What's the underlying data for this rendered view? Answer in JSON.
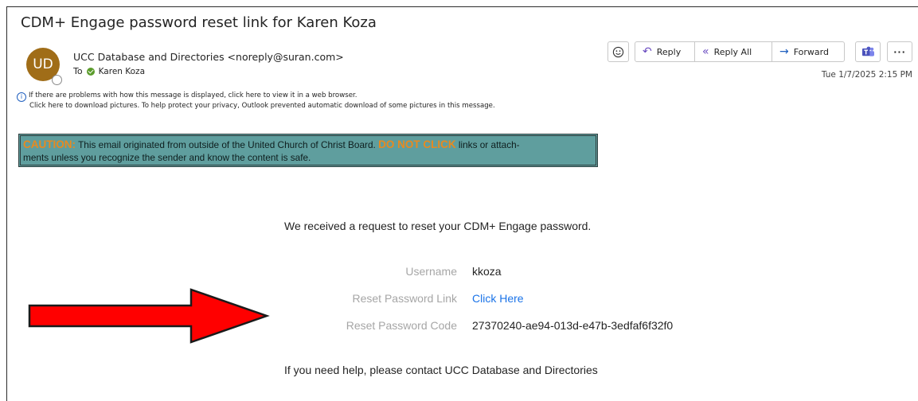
{
  "email": {
    "subject": "CDM+ Engage password reset link for Karen Koza",
    "avatar_initials": "UD",
    "sender": "UCC Database and Directories <noreply@suran.com>",
    "to_label": "To",
    "recipient": "Karen Koza",
    "date": "Tue 1/7/2025 2:15 PM",
    "info_line1": "If there are problems with how this message is displayed, click here to view it in a web browser.",
    "info_line2": "Click here to download pictures. To help protect your privacy, Outlook prevented automatic download of some pictures in this message."
  },
  "toolbar": {
    "reply_label": "Reply",
    "reply_all_label": "Reply All",
    "forward_label": "Forward"
  },
  "icons": {
    "emoji": "smiley-icon",
    "reply": "reply-arrow-icon",
    "reply_all": "reply-all-icon",
    "forward": "forward-arrow-icon",
    "teams": "teams-icon",
    "more": "more-icon",
    "info": "info-icon",
    "annotation": "red-arrow-icon"
  },
  "caution": {
    "prefix": "CAUTION:",
    "text1": " This email originated from outside of the United Church of Christ Board. ",
    "do_not_click": "DO NOT CLICK",
    "text2": " links or attach-",
    "text3": "ments unless you recognize the sender and know the content is safe."
  },
  "message": {
    "intro": "We received a request to reset your CDM+ Engage password.",
    "username_label": "Username",
    "username_value": "kkoza",
    "link_label": "Reset Password Link",
    "link_value": "Click Here",
    "code_label": "Reset Password Code",
    "code_value": "27370240-ae94-013d-e47b-3edfaf6f32f0",
    "help": "If you need help, please contact UCC Database and Directories"
  },
  "colors": {
    "avatar": "#a06d18",
    "caution_bg": "#5f9e9e",
    "caution_highlight": "#e88a1f",
    "link": "#1a73e8",
    "arrow": "#ff0000"
  }
}
